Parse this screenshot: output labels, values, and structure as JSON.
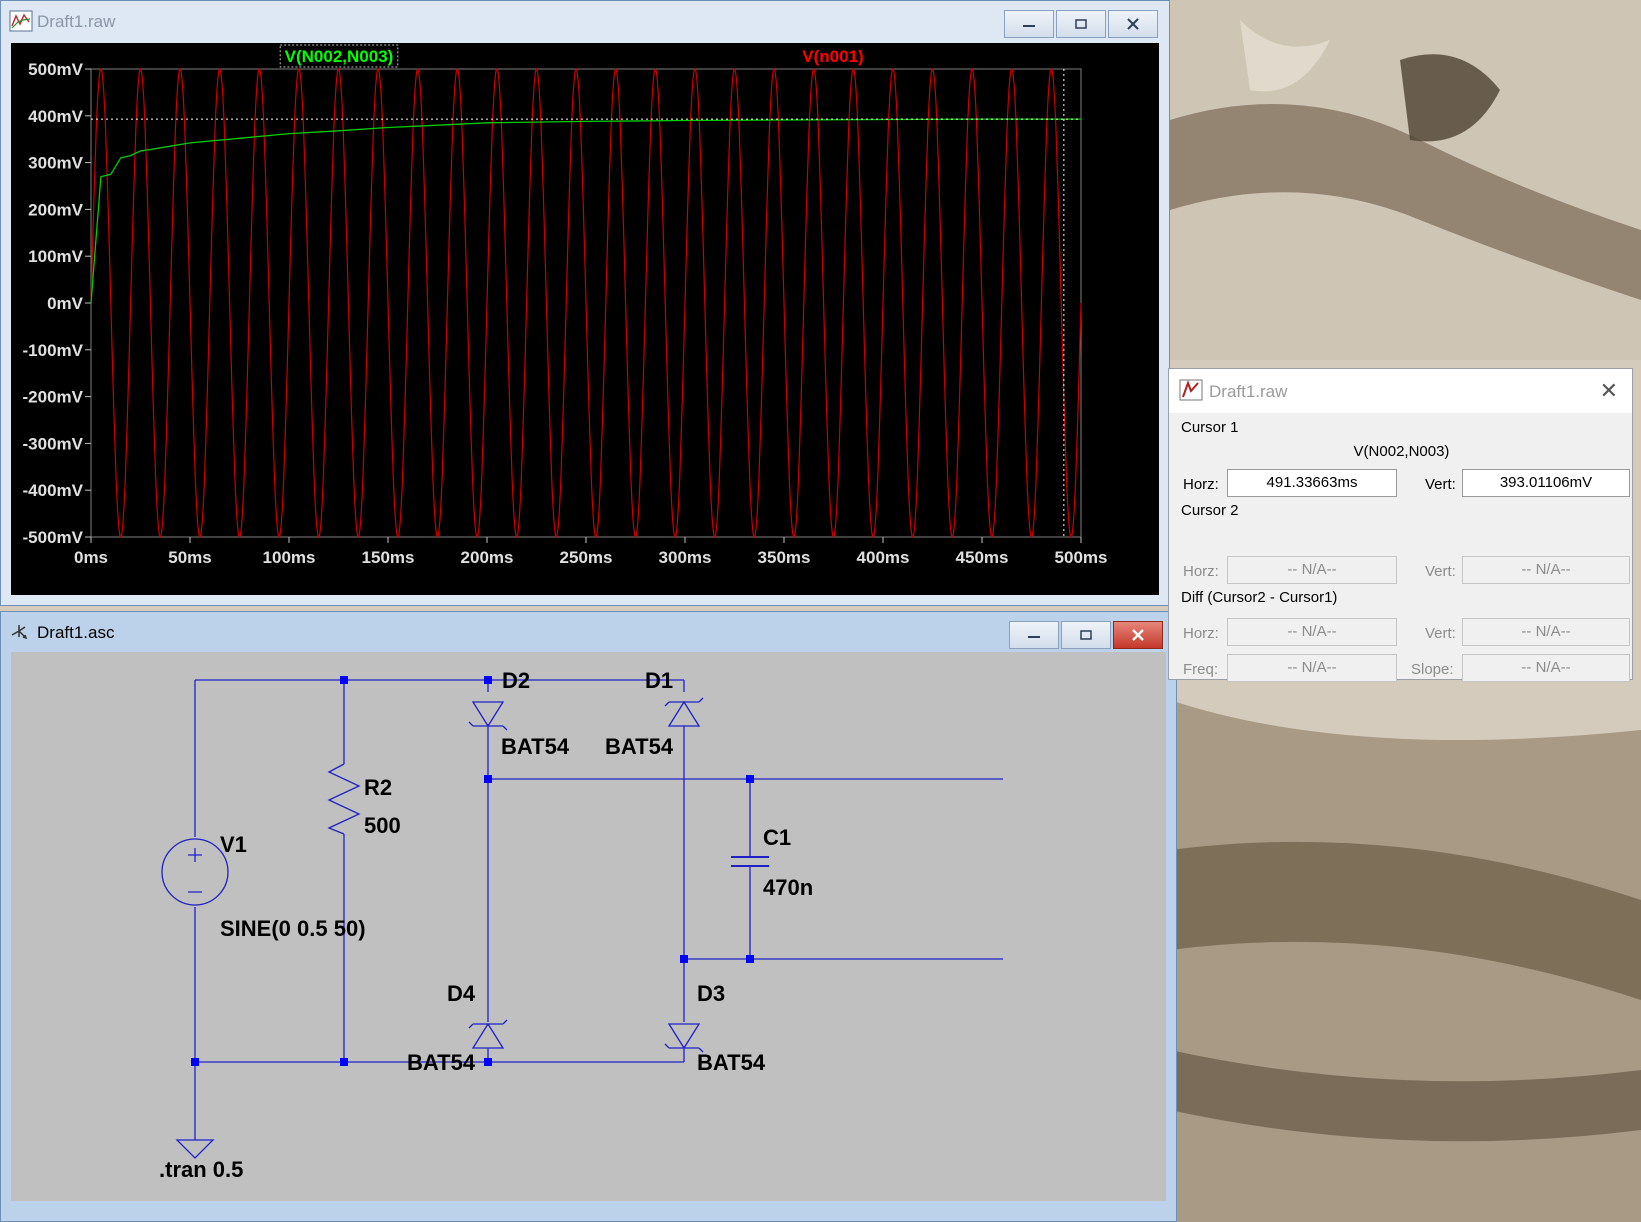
{
  "plot_window": {
    "title": "Draft1.raw",
    "trace_labels": [
      {
        "text": "V(N002,N003)",
        "color": "#00ff00",
        "selected": true
      },
      {
        "text": "V(n001)",
        "color": "#ff0000",
        "selected": false
      }
    ],
    "y_ticks": [
      "500mV",
      "400mV",
      "300mV",
      "200mV",
      "100mV",
      "0mV",
      "-100mV",
      "-200mV",
      "-300mV",
      "-400mV",
      "-500mV"
    ],
    "x_ticks": [
      "0ms",
      "50ms",
      "100ms",
      "150ms",
      "200ms",
      "250ms",
      "300ms",
      "350ms",
      "400ms",
      "450ms",
      "500ms"
    ]
  },
  "chart_data": {
    "type": "line",
    "title": "",
    "xlabel": "",
    "ylabel": "",
    "xlim": [
      0,
      500
    ],
    "ylim": [
      -500,
      500
    ],
    "x_unit": "ms",
    "y_unit": "mV",
    "grid": false,
    "background": "#000000",
    "cursor": {
      "x": 491.33663,
      "y": 393.01106
    },
    "series": [
      {
        "name": "V(N002,N003)",
        "color": "#00cc00",
        "kind": "rectified_envelope",
        "points": [
          [
            0,
            0
          ],
          [
            5,
            270
          ],
          [
            10,
            275
          ],
          [
            15,
            310
          ],
          [
            20,
            315
          ],
          [
            25,
            325
          ],
          [
            30,
            328
          ],
          [
            40,
            335
          ],
          [
            50,
            342
          ],
          [
            75,
            352
          ],
          [
            100,
            362
          ],
          [
            125,
            368
          ],
          [
            150,
            375
          ],
          [
            175,
            380
          ],
          [
            200,
            385
          ],
          [
            250,
            388
          ],
          [
            300,
            390
          ],
          [
            350,
            391
          ],
          [
            400,
            392
          ],
          [
            450,
            393
          ],
          [
            500,
            393
          ]
        ]
      },
      {
        "name": "V(n001)",
        "color": "#cc0000",
        "kind": "sine",
        "amplitude": 500,
        "frequency_hz": 50,
        "offset": 0
      }
    ]
  },
  "schematic_window": {
    "title": "Draft1.asc",
    "labels": {
      "d2": "D2",
      "d2_model": "BAT54",
      "d1": "D1",
      "d1_model": "BAT54",
      "r2": "R2",
      "r2_value": "500",
      "v1": "V1",
      "v1_value": "SINE(0 0.5 50)",
      "c1": "C1",
      "c1_value": "470n",
      "d4": "D4",
      "d4_model": "BAT54",
      "d3": "D3",
      "d3_model": "BAT54",
      "directive": ".tran 0.5"
    },
    "wire_color": "#2020c8",
    "junction_color": "#0000ff"
  },
  "cursor_dialog": {
    "title": "Draft1.raw",
    "cursor1": {
      "heading": "Cursor 1",
      "trace": "V(N002,N003)",
      "horz_label": "Horz:",
      "horz_value": "491.33663ms",
      "vert_label": "Vert:",
      "vert_value": "393.01106mV"
    },
    "cursor2": {
      "heading": "Cursor 2",
      "horz_label": "Horz:",
      "horz_value": "-- N/A--",
      "vert_label": "Vert:",
      "vert_value": "-- N/A--"
    },
    "diff": {
      "heading": "Diff (Cursor2 - Cursor1)",
      "horz_label": "Horz:",
      "horz_value": "-- N/A--",
      "vert_label": "Vert:",
      "vert_value": "-- N/A--",
      "freq_label": "Freq:",
      "freq_value": "-- N/A--",
      "slope_label": "Slope:",
      "slope_value": "-- N/A--"
    }
  }
}
